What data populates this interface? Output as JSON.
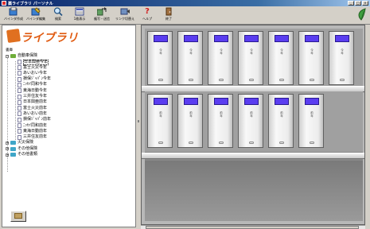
{
  "window": {
    "title": "薬ライブラリ パーソナル"
  },
  "toolbar": {
    "buttons": [
      {
        "label": "バインダ作成",
        "icon": "binder-create-icon"
      },
      {
        "label": "バインダ編集",
        "icon": "binder-edit-icon"
      },
      {
        "label": "検索",
        "icon": "search-icon"
      },
      {
        "label": "1枚表示",
        "icon": "single-view-icon"
      },
      {
        "label": "複写・送信",
        "icon": "copy-send-icon"
      },
      {
        "label": "リンク切替え",
        "icon": "link-switch-icon"
      },
      {
        "label": "ヘルプ",
        "icon": "help-icon"
      },
      {
        "label": "終了",
        "icon": "exit-icon"
      }
    ]
  },
  "library": {
    "logo_text": "ライブラリ",
    "root_label": "書庫",
    "category": "自動車保険",
    "items": [
      "日本興亜今年",
      "富士火災今年",
      "あいおい今年",
      "損保ｼﾞｬﾊﾟﾝ今年",
      "ﾆｯｾｲ同和今年",
      "東海日動今年",
      "三井住友今年",
      "日本興亜前年",
      "富士火災前年",
      "あいおい前年",
      "損保ｼﾞｬﾊﾟﾝ前年",
      "ﾆｯｾｲ同和前年",
      "東海日動前年",
      "三井住友前年"
    ],
    "other_categories": [
      "火災保険",
      "その他保険",
      "その他書類"
    ]
  },
  "shelf": {
    "top_row": [
      "今年",
      "今年",
      "今年",
      "今年",
      "今年",
      "今年",
      "今年"
    ],
    "bottom_row": [
      "前年",
      "前年",
      "前年",
      "前年",
      "前年",
      "前年"
    ],
    "label_color": "#5a3df0"
  }
}
